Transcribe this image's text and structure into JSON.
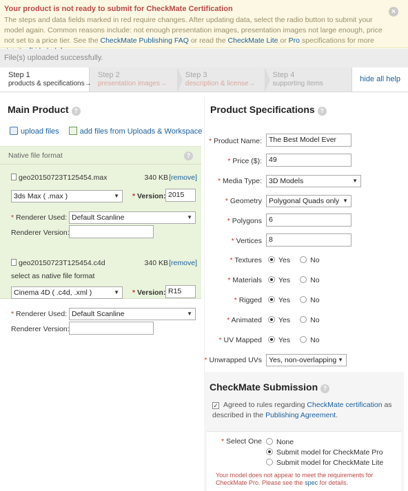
{
  "alert": {
    "title": "Your product is not ready to submit for CheckMate Certification",
    "body_1": "The steps and data fields marked in red require changes. After updating data, select the radio button to submit your model again. Common reasons include: not enough presentation images, presentation images not large enough, price not set to a price tier. See the ",
    "faq_link": "CheckMate Publishing FAQ",
    "body_2": " or read the ",
    "lite_link": "CheckMate Lite",
    "body_3": " or ",
    "pro_link": "Pro",
    "body_4": " specifications for more details. ",
    "hide_link": "[hide help]"
  },
  "notice": "File(s) uploaded successfully.",
  "steps": [
    {
      "num": "Step 1",
      "label": "products & specifications→"
    },
    {
      "num": "Step 2",
      "label": "presentation images→"
    },
    {
      "num": "Step 3",
      "label": "description & license→"
    },
    {
      "num": "Step 4",
      "label": "supporting items"
    }
  ],
  "hide_all_help": "hide all help",
  "main_product": {
    "title": "Main Product",
    "upload_files": "upload files",
    "add_files": "add files from Uploads & Workspace",
    "native_label": "Native file format",
    "files": [
      {
        "name": "geo20150723T125454.max",
        "size": "340 KB",
        "remove": "[remove]",
        "format": "3ds Max ( .max )",
        "version_label": "Version:",
        "version": "2015",
        "renderer_label": "Renderer Used:",
        "renderer": "Default Scanline",
        "renderer_version_label": "Renderer Version:",
        "renderer_version": ""
      },
      {
        "name": "geo20150723T125454.c4d",
        "size": "340 KB",
        "remove": "[remove]",
        "select_native": "select as native file format",
        "format": "Cinema 4D ( .c4d, .xml )",
        "version_label": "Version:",
        "version": "R15",
        "renderer_label": "Renderer Used:",
        "renderer": "Default Scanline",
        "renderer_version_label": "Renderer Version:",
        "renderer_version": ""
      }
    ]
  },
  "specs": {
    "title": "Product Specifications",
    "product_name_label": "Product Name:",
    "product_name": "The Best Model Ever",
    "price_label": "Price ($):",
    "price": "49",
    "media_type_label": "Media Type:",
    "media_type": "3D Models",
    "geometry_label": "Geometry",
    "geometry": "Polygonal Quads only",
    "polygons_label": "Polygons",
    "polygons": "6",
    "vertices_label": "Vertices",
    "vertices": "8",
    "yes": "Yes",
    "no": "No",
    "textures_label": "Textures",
    "materials_label": "Materials",
    "rigged_label": "Rigged",
    "animated_label": "Animated",
    "uv_mapped_label": "UV Mapped",
    "unwrapped_label": "Unwrapped UVs",
    "unwrapped": "Yes, non-overlapping"
  },
  "checkmate": {
    "title": "CheckMate Submission",
    "agree_1": "Agreed to rules regarding ",
    "cert_link": "CheckMate certification",
    "agree_2": " as described in the ",
    "agreement_link": "Publishing Agreement",
    "agree_3": ".",
    "select_one": "Select One",
    "opt_none": "None",
    "opt_pro": "Submit model for CheckMate Pro",
    "opt_lite": "Submit model for CheckMate Lite",
    "warn_1": "Your model does not appear to meet the requirements for CheckMate Pro. Please see the ",
    "spec_link": "spec",
    "warn_2": " for details."
  }
}
